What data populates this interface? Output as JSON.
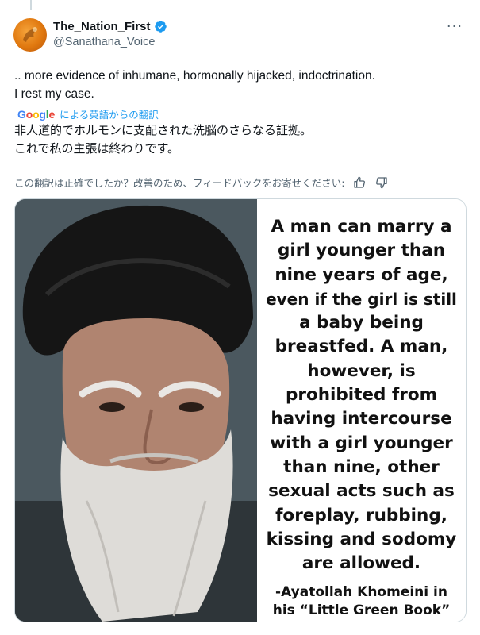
{
  "author": {
    "display_name": "The_Nation_First",
    "handle": "@Sanathana_Voice",
    "verified": true,
    "badge_color": "#1d9bf0"
  },
  "more_menu": {
    "label": "···",
    "icon": "more-horizontal-icon"
  },
  "tweet": {
    "lines": [
      ".. more evidence of inhumane, hormonally hijacked, indoctrination.",
      "I rest my case."
    ]
  },
  "translation": {
    "provider": [
      "G",
      "o",
      "o",
      "g",
      "l",
      "e"
    ],
    "label": "による英語からの翻訳",
    "lines": [
      "非人道的でホルモンに支配された洗脳のさらなる証拠。",
      "これで私の主張は終わりです。"
    ],
    "feedback_prompt": "この翻訳は正確でしたか？改善のため、フィードバックをお寄せください:",
    "thumbs_up_icon": "thumbs-up-icon",
    "thumbs_down_icon": "thumbs-down-icon"
  },
  "media": {
    "quote_lines": [
      "A man can marry a",
      "girl younger than",
      "nine years of age,",
      "even if the girl is still",
      "a baby being",
      "breastfed. A man,",
      "however, is",
      "prohibited from",
      "having intercourse",
      "with a girl younger",
      "than nine, other",
      "sexual acts such as",
      "foreplay, rubbing,",
      "kissing and sodomy",
      "are allowed."
    ],
    "attribution_lines": [
      "-Ayatollah Khomeini in",
      "his “Little Green Book”"
    ]
  },
  "colors": {
    "text_primary": "#0f1419",
    "text_secondary": "#536471",
    "accent_blue": "#1d9bf0",
    "border": "#cfd9de"
  }
}
